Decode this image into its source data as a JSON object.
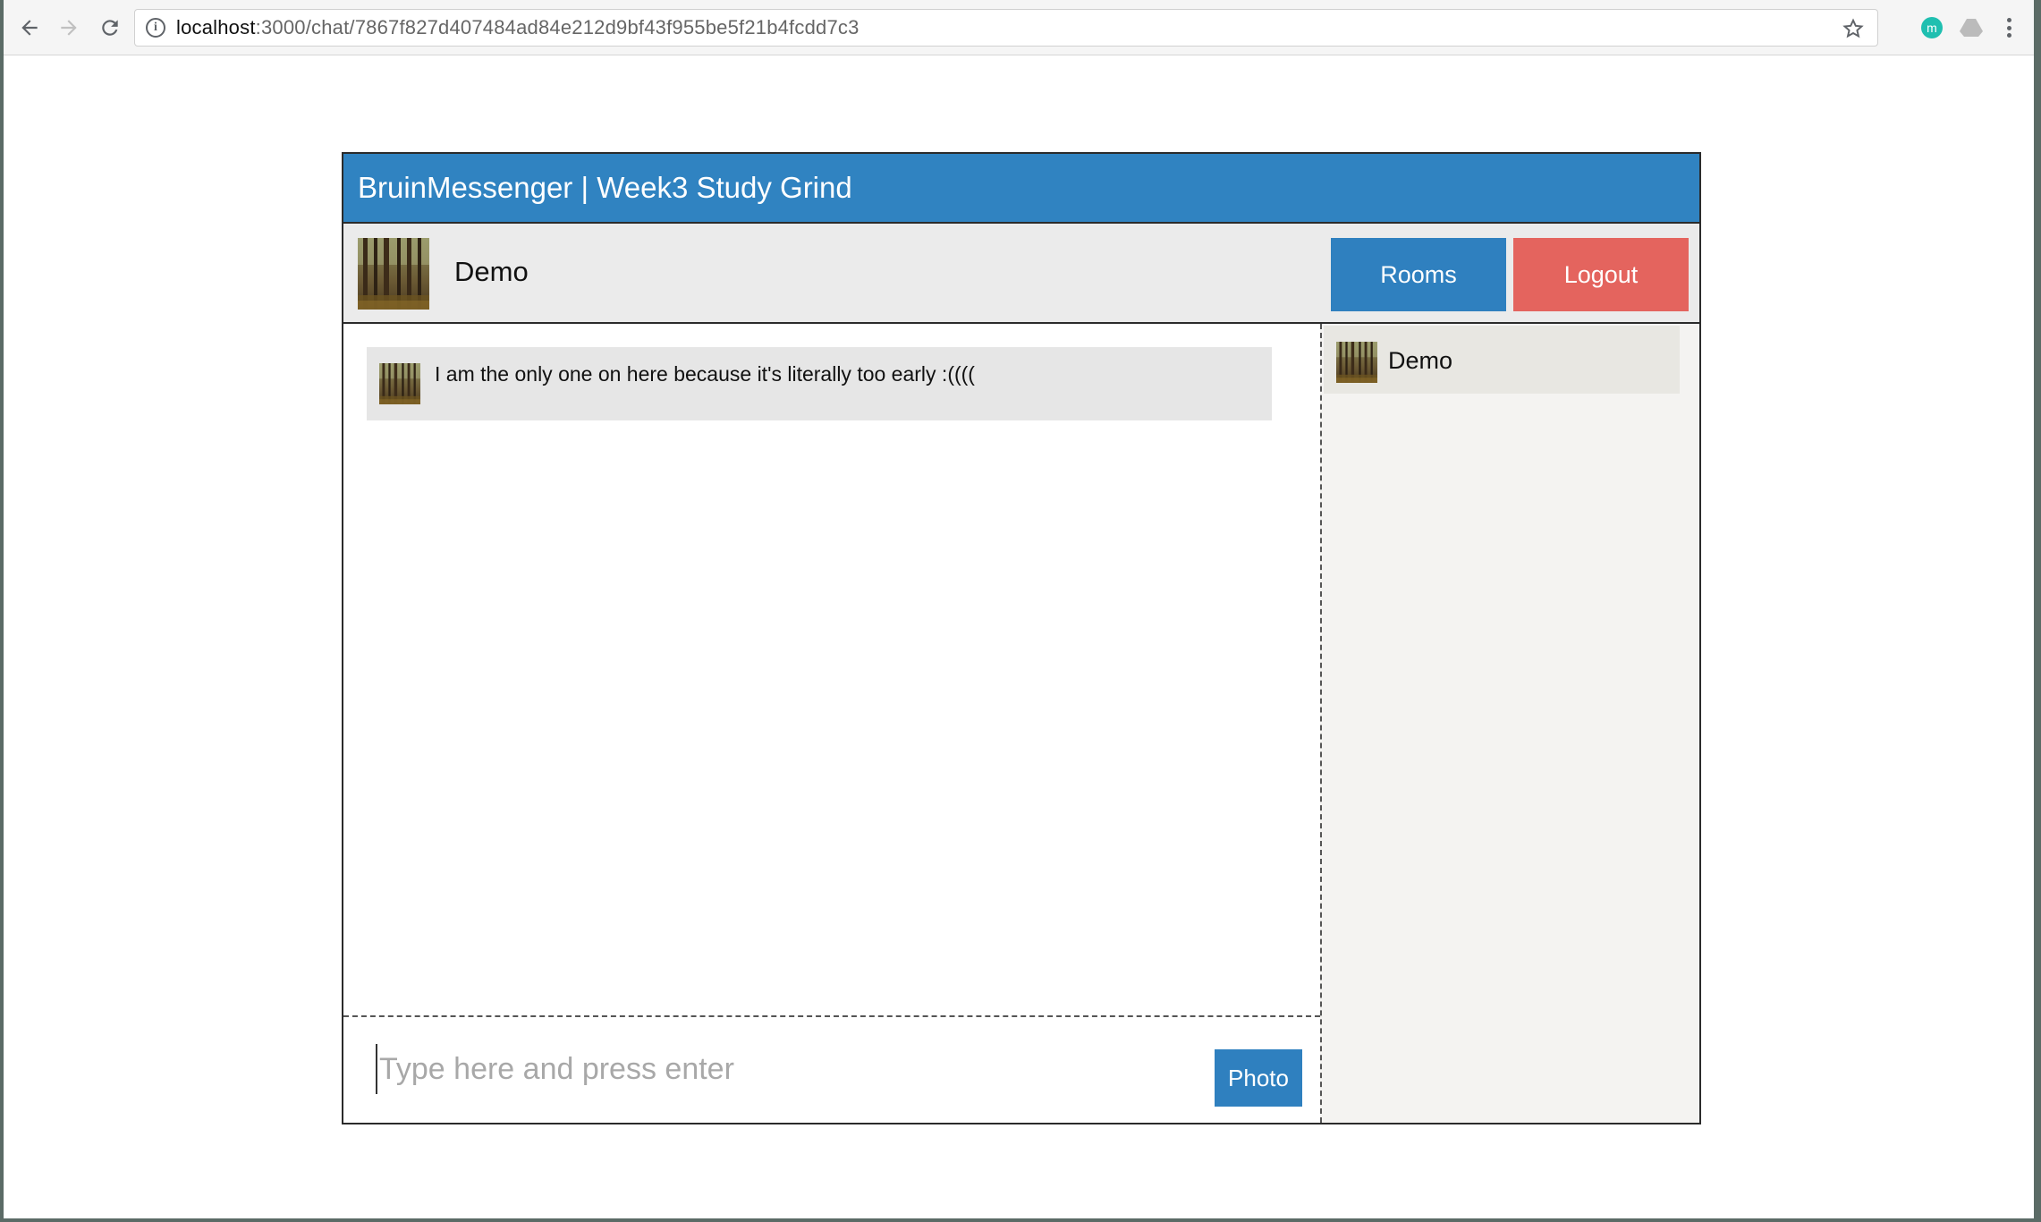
{
  "browser": {
    "url_host": "localhost",
    "url_path": ":3000/chat/7867f827d407484ad84e212d9bf43f955be5f21b4fcdd7c3",
    "icons": {
      "back": "arrow-left-icon",
      "forward": "arrow-right-icon",
      "reload": "reload-icon",
      "info": "info-icon",
      "bookmark": "star-icon",
      "menu": "kebab-menu-icon"
    },
    "extension_1_letter": "m"
  },
  "app": {
    "title": "BruinMessenger | Week3 Study Grind",
    "colors": {
      "header": "#3083c1",
      "rooms_button": "#2f80bf",
      "logout_button": "#e4645e"
    }
  },
  "user_bar": {
    "username": "Demo",
    "rooms_label": "Rooms",
    "logout_label": "Logout"
  },
  "messages": [
    {
      "text": "I am the only one on here because it's literally too early :(((("
    }
  ],
  "composer": {
    "placeholder": "Type here and press enter",
    "value": "",
    "photo_label": "Photo"
  },
  "members": [
    {
      "name": "Demo"
    }
  ]
}
